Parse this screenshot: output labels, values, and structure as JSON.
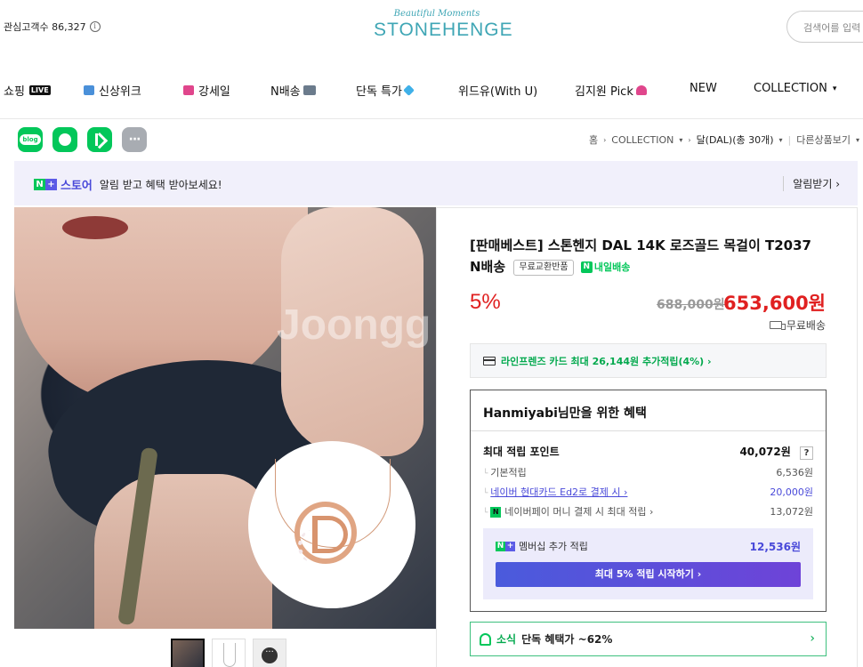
{
  "header": {
    "interest_label": "관심고객수 86,327",
    "logo_tagline": "Beautiful Moments",
    "logo_name": "STONEHENGE",
    "search_placeholder": "검색어를 입력"
  },
  "nav": {
    "items": [
      {
        "label": "쇼핑",
        "badge": "LIVE"
      },
      {
        "label": "신상위크",
        "icon": "shopping-bag-icon"
      },
      {
        "label": "강세일",
        "icon": "ribbon-icon"
      },
      {
        "label": "N배송",
        "icon": "truck-icon"
      },
      {
        "label": "단독 특가",
        "icon": "diamond-icon"
      },
      {
        "label": "위드유(With U)"
      },
      {
        "label": "김지원 Pick",
        "icon": "heart-icon"
      },
      {
        "label": "NEW"
      },
      {
        "label": "COLLECTION",
        "icon": "chevron-down-icon"
      }
    ],
    "colors": {
      "bag": "#4a90d9",
      "ribbon": "#e0468c",
      "diamond": "#3fb0e8",
      "heart": "#e0468c"
    }
  },
  "share": {
    "blog_label": "blog",
    "more_label": "···"
  },
  "breadcrumb": {
    "home": "홈",
    "category": "COLLECTION",
    "current": "달(DAL)(총 30개)",
    "other": "다른상품보기"
  },
  "store_banner": {
    "n_label": "N",
    "plus_label": "+",
    "store_label": "스토어",
    "message": "알림 받고 혜택 받아보세요!",
    "action": "알림받기 ›"
  },
  "product": {
    "watermark": "Joongg",
    "title": "[판매베스트] 스톤헨지 DAL 14K 로즈골드 목걸이 T2037 N배송",
    "return_tag": "무료교환반품",
    "delivery_tag": "내일배송",
    "discount": "5%",
    "original_price": "688,000원",
    "sale_price": "653,600원",
    "shipping": "무료배송",
    "card_benefit": "라인프렌즈 카드 최대 26,144원 추가적립(4%) ›"
  },
  "benefit": {
    "title": "Hanmiyabi님만을 위한 혜택",
    "max_points_label": "최대 적립 포인트",
    "max_points_value": "40,072원",
    "help": "?",
    "rows": [
      {
        "label": "기본적립",
        "value": "6,536원"
      },
      {
        "label": "네이버 현대카드 Ed2로 결제 시 ›",
        "value": "20,000원"
      },
      {
        "label": "네이버페이 머니 결제 시 최대 적립 ›",
        "value": "13,072원"
      }
    ],
    "npay_icon": "N",
    "membership_label": "멤버십 추가 적립",
    "membership_value": "12,536원",
    "cta": "최대 5% 적립 시작하기 ›"
  },
  "news": {
    "title": "소식",
    "text": "단독 혜택가 ~62%",
    "chevron": "›"
  },
  "thumbs": {
    "more": "···"
  }
}
